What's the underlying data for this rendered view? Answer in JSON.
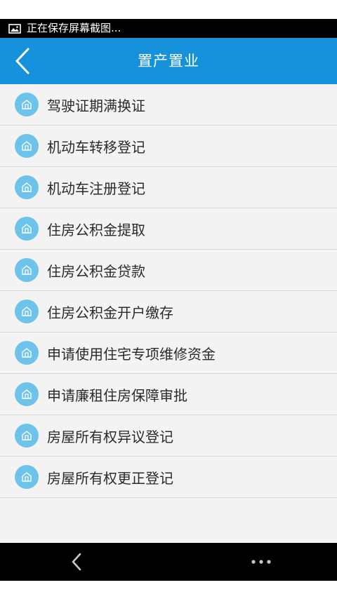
{
  "status_bar": {
    "icon": "image-icon",
    "text": "正在保存屏幕截图..."
  },
  "header": {
    "back_icon": "chevron-left-icon",
    "title": "置产置业"
  },
  "list": {
    "item_icon": "house-icon",
    "items": [
      {
        "label": "驾驶证期满换证"
      },
      {
        "label": "机动车转移登记"
      },
      {
        "label": "机动车注册登记"
      },
      {
        "label": "住房公积金提取"
      },
      {
        "label": "住房公积金贷款"
      },
      {
        "label": "住房公积金开户缴存"
      },
      {
        "label": "申请使用住宅专项维修资金"
      },
      {
        "label": "申请廉租住房保障审批"
      },
      {
        "label": "房屋所有权异议登记"
      },
      {
        "label": "房屋所有权更正登记"
      }
    ]
  },
  "nav_bar": {
    "back_icon": "back-arrow-icon",
    "more_icon": "more-dots-icon"
  },
  "colors": {
    "header": "#1592db",
    "list_background": "#f3f3f3",
    "item_icon": "#6dc3ea",
    "divider": "#d9d9d9"
  }
}
